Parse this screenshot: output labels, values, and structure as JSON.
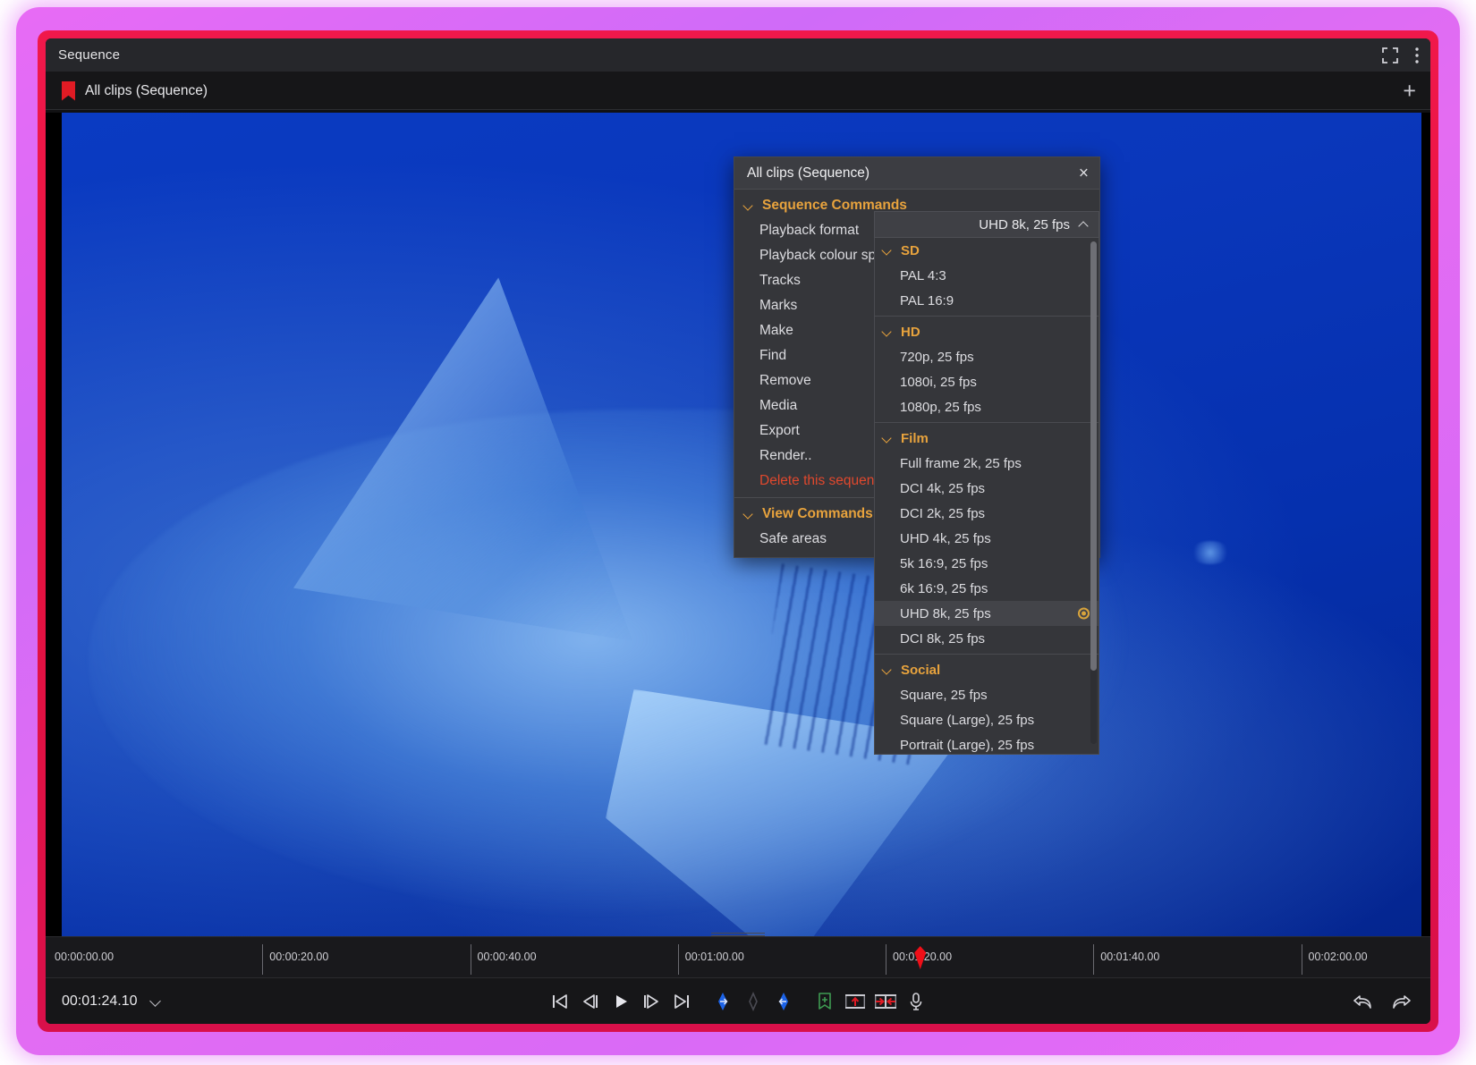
{
  "window": {
    "title": "Sequence",
    "fullscreen_icon": "fullscreen-icon",
    "overflow_icon": "more-vertical-icon"
  },
  "tabs": {
    "active": "All clips (Sequence)",
    "add_label": "+"
  },
  "context_menu": {
    "title": "All clips (Sequence)",
    "close_label": "×",
    "groups": [
      {
        "label": "Sequence Commands",
        "items": [
          {
            "label": "Playback format",
            "type": "submenu"
          },
          {
            "label": "Playback colour space",
            "type": "submenu"
          },
          {
            "label": "Tracks",
            "type": "submenu"
          },
          {
            "label": "Marks",
            "type": "submenu"
          },
          {
            "label": "Make",
            "type": "submenu"
          },
          {
            "label": "Find",
            "type": "submenu"
          },
          {
            "label": "Remove",
            "type": "submenu"
          },
          {
            "label": "Media",
            "type": "submenu"
          },
          {
            "label": "Export",
            "type": "submenu"
          },
          {
            "label": "Render..",
            "type": "action"
          },
          {
            "label": "Delete this sequence",
            "type": "danger"
          }
        ]
      },
      {
        "label": "View Commands",
        "items": [
          {
            "label": "Safe areas",
            "type": "submenu"
          }
        ]
      }
    ]
  },
  "format_dropdown": {
    "current_value": "UHD 8k, 25 fps",
    "selected": "UHD 8k, 25 fps",
    "sections": [
      {
        "label": "SD",
        "options": [
          "PAL 4:3",
          "PAL 16:9"
        ]
      },
      {
        "label": "HD",
        "options": [
          "720p, 25 fps",
          "1080i, 25 fps",
          "1080p, 25 fps"
        ]
      },
      {
        "label": "Film",
        "options": [
          "Full frame 2k, 25 fps",
          "DCI 4k, 25 fps",
          "DCI 2k, 25 fps",
          "UHD 4k, 25 fps",
          "5k 16:9, 25 fps",
          "6k 16:9, 25 fps",
          "UHD 8k, 25 fps",
          "DCI 8k, 25 fps"
        ]
      },
      {
        "label": "Social",
        "options": [
          "Square, 25 fps",
          "Square (Large), 25 fps",
          "Portrait (Large), 25 fps"
        ]
      }
    ]
  },
  "ruler": {
    "ticks": [
      {
        "label": "00:00:00.00",
        "pct": 0
      },
      {
        "label": "00:00:20.00",
        "pct": 15.2
      },
      {
        "label": "00:00:40.00",
        "pct": 30.4
      },
      {
        "label": "00:01:00.00",
        "pct": 45.6
      },
      {
        "label": "00:01:20.00",
        "pct": 60.8
      },
      {
        "label": "00:01:40.00",
        "pct": 76.0
      },
      {
        "label": "00:02:00.00",
        "pct": 91.2
      }
    ],
    "playhead_pct": 63.3
  },
  "transport": {
    "timecode": "00:01:24.10",
    "buttons": [
      {
        "name": "go-to-start-button",
        "icon": "skip-to-start-icon"
      },
      {
        "name": "step-back-button",
        "icon": "step-backward-icon"
      },
      {
        "name": "play-button",
        "icon": "play-icon"
      },
      {
        "name": "step-forward-button",
        "icon": "step-forward-icon"
      },
      {
        "name": "go-to-end-button",
        "icon": "skip-to-end-icon"
      },
      {
        "name": "mark-in-button",
        "icon": "mark-in-icon"
      },
      {
        "name": "mark-clip-button",
        "icon": "mark-diamond-icon"
      },
      {
        "name": "mark-out-button",
        "icon": "mark-out-icon"
      },
      {
        "name": "add-marker-button",
        "icon": "add-marker-icon"
      },
      {
        "name": "lift-button",
        "icon": "lift-up-icon"
      },
      {
        "name": "extract-button",
        "icon": "extract-icon"
      },
      {
        "name": "voiceover-button",
        "icon": "microphone-icon"
      }
    ],
    "undo_icon": "undo-arrow-icon",
    "redo_icon": "redo-arrow-icon"
  },
  "colors": {
    "accent_orange": "#e8a33d",
    "danger_red": "#e0482d",
    "playhead_red": "#ef0f18",
    "frame_red": "#e8123f",
    "glow_magenta": "#e86bf5",
    "panel_bg": "#35363a",
    "selected_row": "#434449"
  }
}
